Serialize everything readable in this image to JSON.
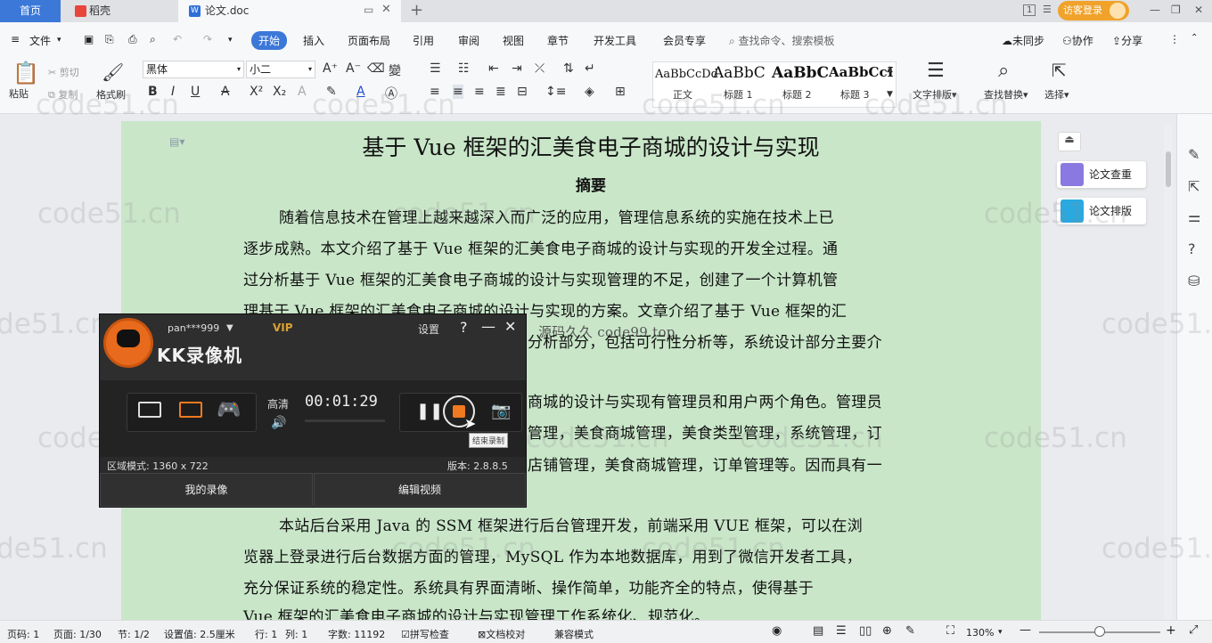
{
  "tabs": {
    "home": "首页",
    "daoke": "稻壳",
    "doc": "论文.doc",
    "add": "+"
  },
  "topright": {
    "visitor_login": "访客登录",
    "box": "1"
  },
  "menu": {
    "file": "文件",
    "items": [
      "开始",
      "插入",
      "页面布局",
      "引用",
      "审阅",
      "视图",
      "章节",
      "开发工具",
      "会员专享"
    ],
    "search_placeholder": "查找命令、搜索模板",
    "sync": "未同步",
    "collab": "协作",
    "share": "分享"
  },
  "ribbon": {
    "paste": "粘贴",
    "cut": "剪切",
    "copy": "复制",
    "format_painter": "格式刷",
    "font_name": "黑体",
    "font_size": "小二",
    "styles": [
      {
        "preview": "AaBbCcDd",
        "label": "正文"
      },
      {
        "preview": "AaBbC",
        "label": "标题 1"
      },
      {
        "preview": "AaBbC",
        "label": "标题 2"
      },
      {
        "preview": "AaBbCcI",
        "label": "标题 3"
      }
    ],
    "text_layout": "文字排版",
    "find_replace": "查找替换",
    "select": "选择"
  },
  "document": {
    "title": "基于 Vue 框架的汇美食电子商城的设计与实现",
    "abstract_heading": "摘要",
    "lines": [
      "随着信息技术在管理上越来越深入而广泛的应用，管理信息系统的实施在技术上已",
      "逐步成熟。本文介绍了基于 Vue 框架的汇美食电子商城的设计与实现的开发全过程。通",
      "过分析基于 Vue 框架的汇美食电子商城的设计与实现管理的不足，创建了一个计算机管",
      "理基于 Vue 框架的汇美食电子商城的设计与实现的方案。文章介绍了基于 Vue 框架的汇",
      "源码久久 code99.top",
      "分析部分，包括可行性分析等，系统设计部分主要介",
      "商城的设计与实现有管理员和用户两个角色。管理员",
      "管理，美食商城管理，美食类型管理，系统管理，订",
      "店铺管理，美食商城管理，订单管理等。因而具有一",
      "本站后台采用 Java 的 SSM 框架进行后台管理开发，前端采用 VUE 框架，可以在浏",
      "览器上登录进行后台数据方面的管理，MySQL 作为本地数据库，用到了微信开发者工具，",
      "充分保证系统的稳定性。系统具有界面清晰、操作简单，功能齐全的特点，使得基于",
      "Vue 框架的汇美食电子商城的设计与实现管理工作系统化、规范化。"
    ]
  },
  "right_panel": {
    "check": "论文查重",
    "layout": "论文排版"
  },
  "status": {
    "page": "页码: 1",
    "pages": "页面: 1/30",
    "section": "节: 1/2",
    "setting": "设置值: 2.5厘米",
    "row": "行: 1",
    "col": "列: 1",
    "words": "字数: 11192",
    "spell": "拼写检查",
    "proof": "文档校对",
    "compat": "兼容模式",
    "zoom": "130%"
  },
  "recorder": {
    "user": "pan***999",
    "vip": "VIP",
    "brand": "KK录像机",
    "settings": "设置",
    "help": "?",
    "quality": "高清",
    "time": "00:01:29",
    "region": "区域模式: 1360 x 722",
    "version": "版本: 2.8.8.5",
    "my_videos": "我的录像",
    "edit_video": "编辑视频",
    "tooltip": "结束录制"
  },
  "watermark": "code51.cn",
  "colors": {
    "accent": "#3b78d8",
    "page_bg": "#c9e6c9",
    "recorder_orange": "#f07a1f",
    "visitor_btn": "#f0a22a"
  }
}
